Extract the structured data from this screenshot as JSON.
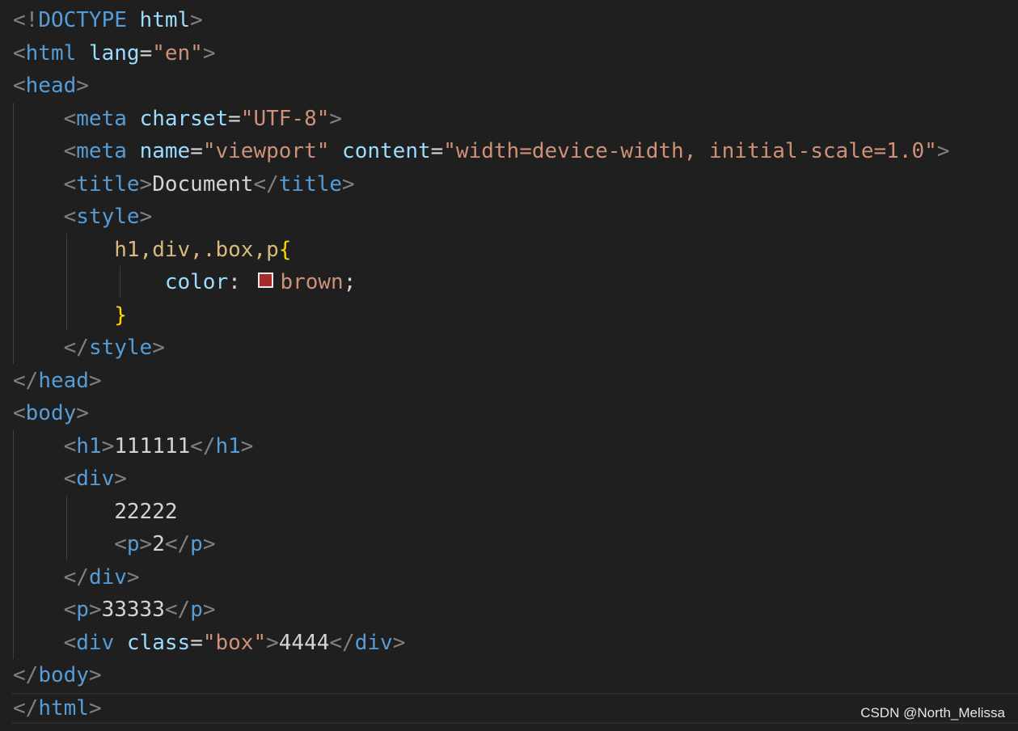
{
  "editor": {
    "colors": {
      "background": "#1f1f1f",
      "punctuation": "#808080",
      "tag": "#569cd6",
      "attribute": "#9cdcfe",
      "string": "#ce9178",
      "text": "#d4d4d4",
      "selector": "#d7ba7d",
      "brace": "#ffd700",
      "swatch": "#a52a2a"
    },
    "lines": [
      {
        "tokens": [
          "<!",
          "DOCTYPE",
          " ",
          "html",
          ">"
        ]
      },
      {
        "tokens": [
          "<",
          "html",
          " ",
          "lang",
          "=",
          "\"en\"",
          ">"
        ]
      },
      {
        "tokens": [
          "<",
          "head",
          ">"
        ]
      },
      {
        "tokens": [
          "    ",
          "<",
          "meta",
          " ",
          "charset",
          "=",
          "\"UTF-8\"",
          ">"
        ]
      },
      {
        "tokens": [
          "    ",
          "<",
          "meta",
          " ",
          "name",
          "=",
          "\"viewport\"",
          " ",
          "content",
          "=",
          "\"width=device-width, initial-scale=1.0\"",
          ">"
        ]
      },
      {
        "tokens": [
          "    ",
          "<",
          "title",
          ">",
          "Document",
          "</",
          "title",
          ">"
        ]
      },
      {
        "tokens": [
          "    ",
          "<",
          "style",
          ">"
        ]
      },
      {
        "tokens": [
          "        ",
          "h1,div,.box,p",
          "{"
        ]
      },
      {
        "tokens": [
          "            ",
          "color",
          ": ",
          "brown",
          ";"
        ]
      },
      {
        "tokens": [
          "        ",
          "}"
        ]
      },
      {
        "tokens": [
          "    ",
          "</",
          "style",
          ">"
        ]
      },
      {
        "tokens": [
          "</",
          "head",
          ">"
        ]
      },
      {
        "tokens": [
          "<",
          "body",
          ">"
        ]
      },
      {
        "tokens": [
          "    ",
          "<",
          "h1",
          ">",
          "111111",
          "</",
          "h1",
          ">"
        ]
      },
      {
        "tokens": [
          "    ",
          "<",
          "div",
          ">"
        ]
      },
      {
        "tokens": [
          "        ",
          "22222"
        ]
      },
      {
        "tokens": [
          "        ",
          "<",
          "p",
          ">",
          "2",
          "</",
          "p",
          ">"
        ]
      },
      {
        "tokens": [
          "    ",
          "</",
          "div",
          ">"
        ]
      },
      {
        "tokens": [
          "    ",
          "<",
          "p",
          ">",
          "33333",
          "</",
          "p",
          ">"
        ]
      },
      {
        "tokens": [
          "    ",
          "<",
          "div",
          " ",
          "class",
          "=",
          "\"box\"",
          ">",
          "4444",
          "</",
          "div",
          ">"
        ]
      },
      {
        "tokens": [
          "</",
          "body",
          ">"
        ]
      },
      {
        "tokens": [
          "</",
          "html",
          ">"
        ]
      }
    ]
  },
  "watermark": "CSDN @North_Melissa"
}
